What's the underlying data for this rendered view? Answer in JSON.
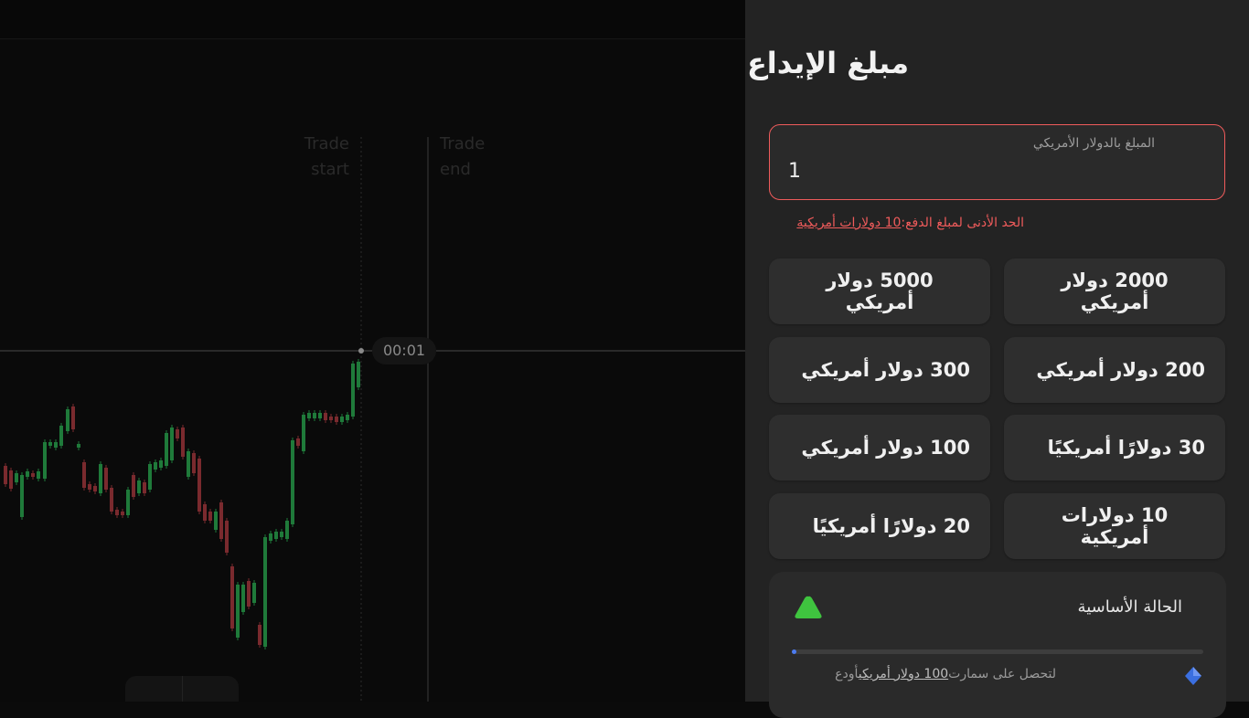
{
  "chart": {
    "trade_start": [
      "Trade",
      "start"
    ],
    "trade_end": [
      "Trade",
      "end"
    ],
    "timer": "00:01",
    "colors": {
      "up": "#1f7a3a",
      "down": "#7a2a2e",
      "line": "#5a5a5a"
    }
  },
  "deposit": {
    "title": "مبلغ الإيداع",
    "amount_label": "المبلغ بالدولار الأمريكي",
    "amount_value": "1",
    "min_warning_prefix": "الحد الأدنى لمبلغ الدفع:",
    "min_warning_link": "10 دولارات أمريكية",
    "presets": [
      "2000 دولار أمريكي",
      "5000 دولار أمريكي",
      "200 دولار أمريكي",
      "300 دولار أمريكي",
      "30 دولارًا أمريكيًا",
      "100 دولار أمريكي",
      "10 دولارات أمريكية",
      "20 دولارًا أمريكيًا"
    ],
    "status": {
      "title": "الحالة الأساسية",
      "progress": 0.01,
      "hint_prefix": "أودع",
      "hint_link": "100 دولار أمريكي",
      "hint_suffix": "لتحصل على سمارت",
      "icon_color": "#3fc43f",
      "diamond_color": "#3b6fe0"
    },
    "accent": "#ef5b5b"
  }
}
